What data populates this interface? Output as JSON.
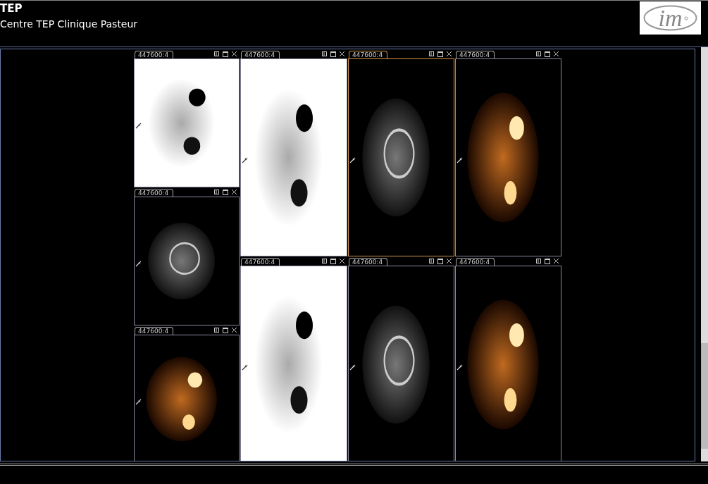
{
  "header": {
    "title": "TEP",
    "subtitle": "Centre TEP Clinique Pasteur",
    "logo": "im"
  },
  "columns": [
    {
      "panels": [
        {
          "label": "447600:4",
          "kind": "pet",
          "selected": false
        },
        {
          "label": "447600:4",
          "kind": "ct",
          "selected": false
        },
        {
          "label": "447600:4",
          "kind": "fusion",
          "selected": false
        }
      ]
    },
    {
      "panels": [
        {
          "label": "447600:4",
          "kind": "pet",
          "selected": false
        },
        {
          "label": "447600:4",
          "kind": "pet",
          "selected": false
        }
      ]
    },
    {
      "panels": [
        {
          "label": "447600:4",
          "kind": "ct",
          "selected": true
        },
        {
          "label": "447600:4",
          "kind": "ct",
          "selected": false
        }
      ]
    },
    {
      "panels": [
        {
          "label": "447600:4",
          "kind": "fusion",
          "selected": false
        },
        {
          "label": "447600:4",
          "kind": "fusion",
          "selected": false
        }
      ]
    }
  ]
}
